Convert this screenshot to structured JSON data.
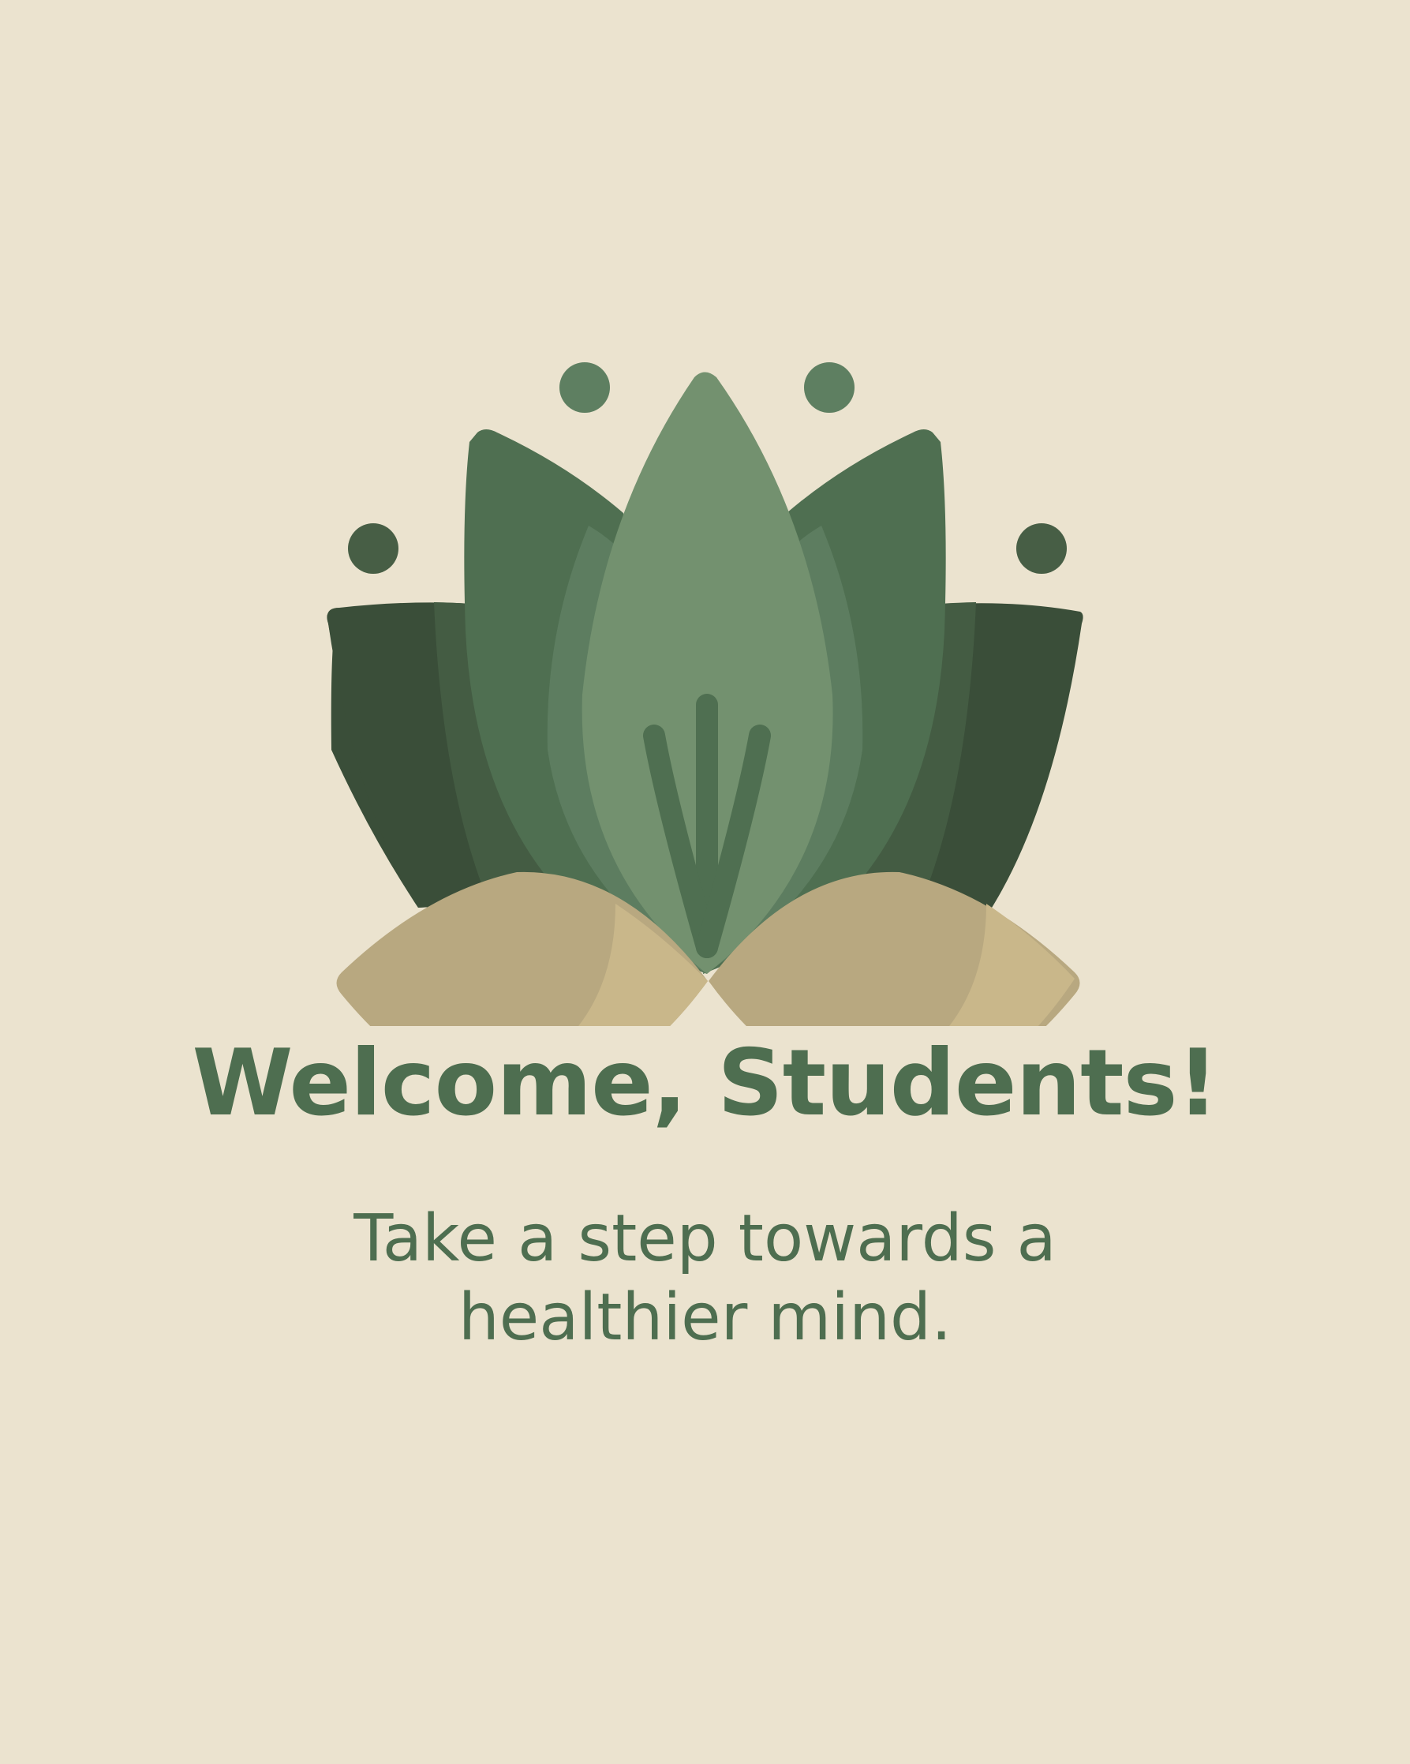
{
  "heading": "Welcome, Students!",
  "subtitle": {
    "line1": "Take a step towards a",
    "line2": "healthier mind."
  },
  "logo": {
    "icon": "lotus-icon"
  },
  "colors": {
    "background": "#ebe3cf",
    "text": "#4e6e50",
    "petal_center": "#73916f",
    "petal_mid": "#4f6f51",
    "petal_back": "#3a4e39",
    "leaf_tan": "#b8a880",
    "leaf_tan_light": "#c9b78a"
  }
}
